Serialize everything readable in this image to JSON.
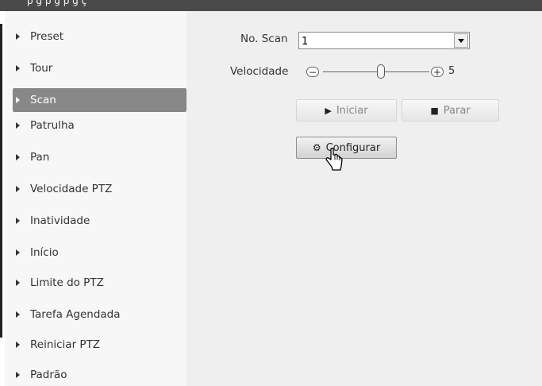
{
  "top_bar": {
    "text": "p  g     p       g       p    g  ç"
  },
  "sidebar": {
    "items": [
      {
        "label": "Preset",
        "active": false
      },
      {
        "label": "Tour",
        "active": false
      },
      {
        "label": "Scan",
        "active": true
      },
      {
        "label": "Patrulha",
        "active": false
      },
      {
        "label": "Pan",
        "active": false
      },
      {
        "label": "Velocidade PTZ",
        "active": false
      },
      {
        "label": "Inatividade",
        "active": false
      },
      {
        "label": "Início",
        "active": false
      },
      {
        "label": "Limite do PTZ",
        "active": false
      },
      {
        "label": "Tarefa Agendada",
        "active": false
      },
      {
        "label": "Reiniciar PTZ",
        "active": false
      },
      {
        "label": "Padrão",
        "active": false
      }
    ]
  },
  "scan": {
    "no_scan_label": "No. Scan",
    "no_scan_value": "1",
    "velocidade_label": "Velocidade",
    "velocidade_minus": "−",
    "velocidade_plus": "+",
    "velocidade_value": "5",
    "velocidade_level_fraction": 0.5,
    "iniciar_label": "Iniciar",
    "parar_label": "Parar",
    "configurar_label": "Configurar"
  },
  "icons": {
    "dropdown": "triangle-down",
    "play": "play-icon",
    "stop": "stop-icon",
    "gear": "gear-icon",
    "cursor": "hand-pointer-icon"
  },
  "colors": {
    "sidebar_bg": "#f7f7f7",
    "sidebar_active_bg": "#888888",
    "main_bg": "#efefef",
    "topbar_bg": "#4a4a4a"
  }
}
